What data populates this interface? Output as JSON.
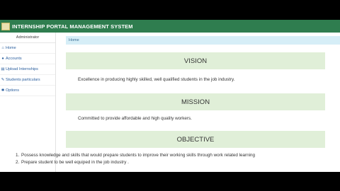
{
  "app": {
    "title": "INTERNSHIP PORTAL MANAGEMENT SYSTEM"
  },
  "sidebar": {
    "user": "Administrator",
    "items": [
      {
        "icon": "home-icon",
        "label": "Home"
      },
      {
        "icon": "user-icon",
        "label": "Accounts"
      },
      {
        "icon": "upload-icon",
        "label": "Upload Internships"
      },
      {
        "icon": "pin-icon",
        "label": "Students particulars"
      },
      {
        "icon": "gear-icon",
        "label": "Options"
      }
    ]
  },
  "breadcrumb": {
    "label": "Home"
  },
  "sections": {
    "vision": {
      "heading": "VISION",
      "text": "Excellence in producing highly skilled, well qualified students in the job industry."
    },
    "mission": {
      "heading": "MISSION",
      "text": "Committed to provide affordable and high quality workers."
    },
    "objective": {
      "heading": "OBJECTIVE",
      "items": [
        "Possess knowledge and skills that would prepare students to improve their working skills through work related learning",
        "Prepare student to be well equiped in the job industry ."
      ]
    }
  }
}
